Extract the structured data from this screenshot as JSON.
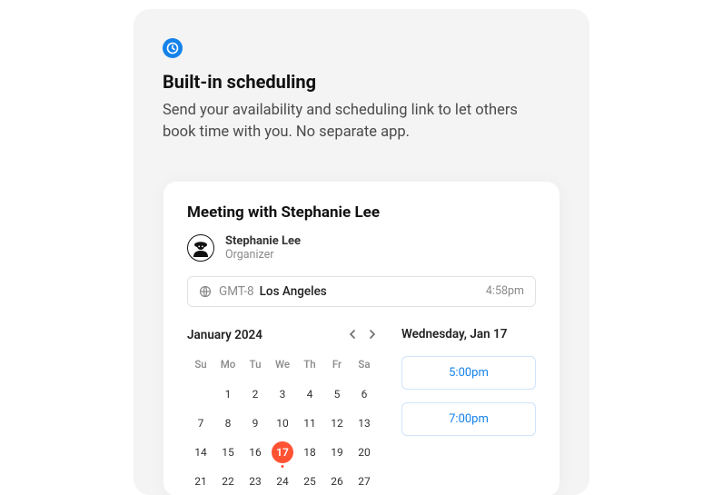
{
  "feature": {
    "heading": "Built-in scheduling",
    "description": "Send your availability and scheduling link to let others book time with you. No separate app."
  },
  "scheduler": {
    "title": "Meeting with Stephanie Lee",
    "organizer": {
      "name": "Stephanie Lee",
      "role": "Organizer"
    },
    "timezone": {
      "offset": "GMT-8",
      "city": "Los Angeles",
      "localTime": "4:58pm"
    },
    "calendar": {
      "monthLabel": "January 2024",
      "dayHeaders": [
        "Su",
        "Mo",
        "Tu",
        "We",
        "Th",
        "Fr",
        "Sa"
      ],
      "weeks": [
        [
          "",
          "1",
          "2",
          "3",
          "4",
          "5",
          "6"
        ],
        [
          "7",
          "8",
          "9",
          "10",
          "11",
          "12",
          "13"
        ],
        [
          "14",
          "15",
          "16",
          "17",
          "18",
          "19",
          "20"
        ],
        [
          "21",
          "22",
          "23",
          "24",
          "25",
          "26",
          "27"
        ]
      ],
      "selectedDay": "17"
    },
    "dayDetail": {
      "label": "Wednesday, Jan 17",
      "slots": [
        "5:00pm",
        "7:00pm"
      ]
    }
  },
  "icons": {
    "clock": "clock-icon",
    "globe": "globe-icon",
    "prev": "chevron-left-icon",
    "next": "chevron-right-icon"
  }
}
